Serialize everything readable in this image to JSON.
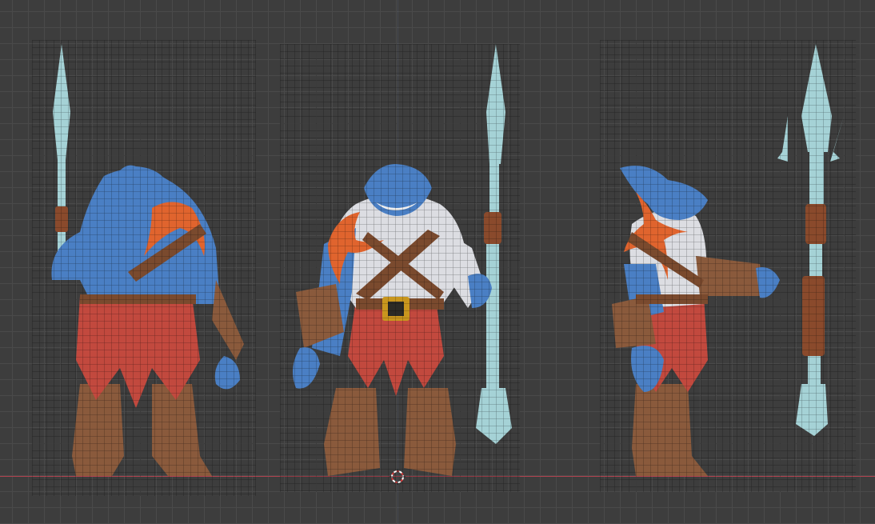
{
  "viewport": {
    "type": "3d-viewport",
    "shading": "wireframe-over-solid",
    "colors": {
      "background": "#3d3d3d",
      "grid": "#4a4a4a",
      "x_axis": "#b0434f",
      "skin_blue": "#4a7fc4",
      "belly_white": "#dcdde2",
      "starfish": "#e0642e",
      "cloth_red": "#c2493e",
      "leather": "#8a5a3c",
      "spear_shaft": "#a5d2d6"
    }
  },
  "objects": [
    {
      "name": "shark-warrior-back-view",
      "icon": "shark-character"
    },
    {
      "name": "shark-warrior-front-view",
      "icon": "shark-character"
    },
    {
      "name": "shark-warrior-side-view",
      "icon": "shark-character"
    }
  ],
  "cursor": {
    "icon": "3d-cursor-icon"
  }
}
